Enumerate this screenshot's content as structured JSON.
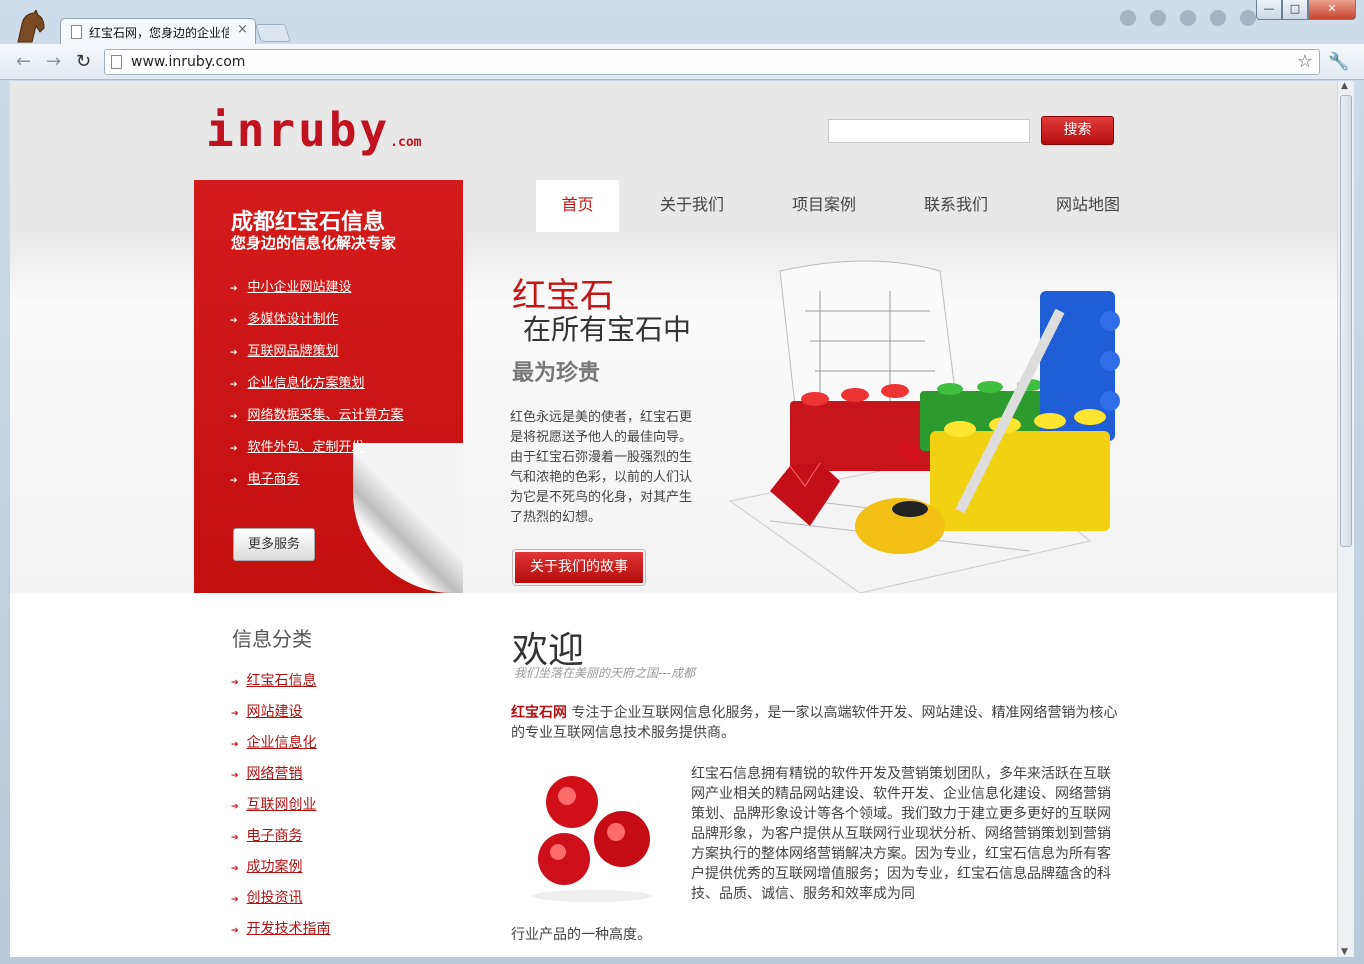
{
  "browser": {
    "tab_title": "红宝石网，您身边的企业信",
    "tab_close": "×",
    "url": "www.inruby.com",
    "window_controls": {
      "minimize": "—",
      "maximize": "□",
      "close": "✕"
    }
  },
  "header": {
    "logo_main": "inruby",
    "logo_suffix": ".com",
    "search_placeholder": "",
    "search_button": "搜索"
  },
  "nav": {
    "items": [
      "首页",
      "关于我们",
      "项目案例",
      "联系我们",
      "网站地图"
    ],
    "active": "首页"
  },
  "red_panel": {
    "title": "成都红宝石信息",
    "subtitle": "您身边的信息化解决专家",
    "services": [
      "中小企业网站建设",
      "多媒体设计制作",
      "互联网品牌策划",
      "企业信息化方案策划",
      "网络数据采集、云计算方案",
      "软件外包、定制开发",
      "电子商务"
    ],
    "more_button": "更多服务"
  },
  "hero": {
    "h1": "红宝石",
    "h2": "在所有宝石中",
    "h3": "最为珍贵",
    "paragraph": "红色永远是美的使者，红宝石更是将祝愿送予他人的最佳向导。由于红宝石弥漫着一股强烈的生气和浓艳的色彩，以前的人们认为它是不死鸟的化身，对其产生了热烈的幻想。",
    "button": "关于我们的故事"
  },
  "categories": {
    "title": "信息分类",
    "items": [
      "红宝石信息",
      "网站建设",
      "企业信息化",
      "网络营销",
      "互联网创业",
      "电子商务",
      "成功案例",
      "创投资讯",
      "开发技术指南"
    ]
  },
  "welcome": {
    "title": "欢迎",
    "subtitle": "我们坐落在美丽的天府之国---成都",
    "brand": "红宝石网",
    "intro": " 专注于企业互联网信息化服务，是一家以高端软件开发、网站建设、精准网络营销为核心的专业互联网信息技术服务提供商。",
    "body": "红宝石信息拥有精锐的软件开发及营销策划团队，多年来活跃在互联网产业相关的精品网站建设、软件开发、企业信息化建设、网络营销策划、品牌形象设计等各个领域。我们致力于建立更多更好的互联网品牌形象，为客户提供从互联网行业现状分析、网络营销策划到营销方案执行的整体网络营销解决方案。因为专业，红宝石信息为所有客户提供优秀的互联网增值服务；因为专业，红宝石信息品牌蕴含的科技、品质、诚信、服务和效率成为同",
    "tail": "行业产品的一种高度。"
  },
  "colors": {
    "brand_red": "#c41515",
    "panel_red": "#d41b1b"
  }
}
